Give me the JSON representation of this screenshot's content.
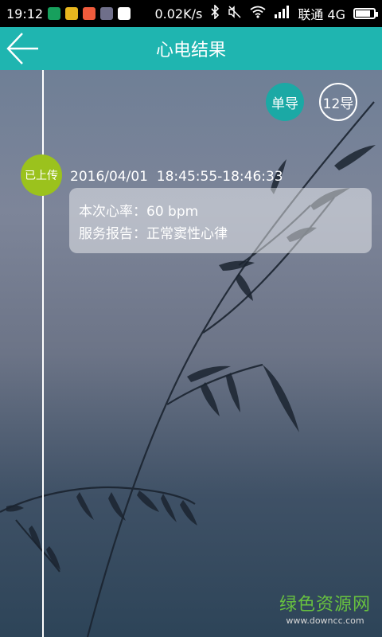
{
  "status_bar": {
    "time": "19:12",
    "network_speed": "0.02K/s",
    "carrier": "联通 4G",
    "battery_level": 0.8,
    "icons": [
      "shield-app-icon",
      "browser-app-icon",
      "game-app-icon",
      "settings-app-icon",
      "health-app-icon",
      "bluetooth-icon",
      "mute-icon",
      "wifi-icon",
      "signal-icon",
      "battery-icon"
    ]
  },
  "header": {
    "title": "心电结果",
    "back_icon": "back-arrow-icon"
  },
  "leads": {
    "single_label": "单导",
    "twelve_label": "12导"
  },
  "record": {
    "upload_status": "已上传",
    "time_range": "2016/04/01  18:45:55-18:46:33",
    "heart_rate": "本次心率：60 bpm",
    "report": "服务报告：正常窦性心律"
  },
  "watermark": {
    "name": "绿色资源网",
    "url": "www.downcc.com"
  },
  "colors": {
    "accent": "#1fb5b0",
    "badge": "#9bc21d",
    "lead_selected": "#1ba9a5"
  }
}
